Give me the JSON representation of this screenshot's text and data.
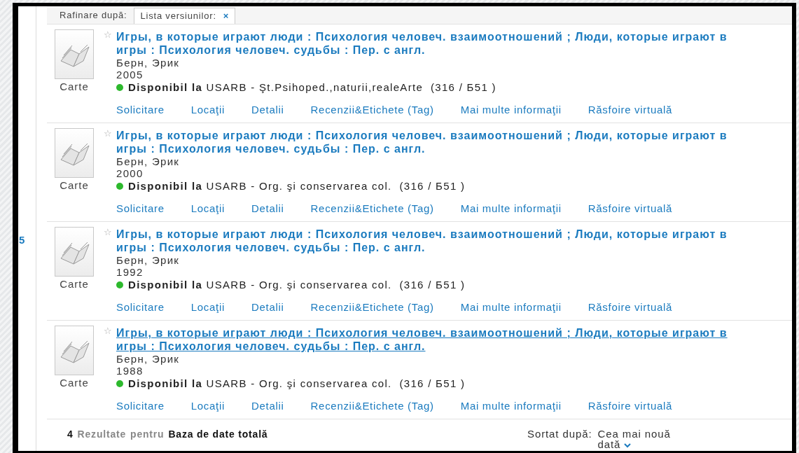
{
  "refine_bar": {
    "label": "Rafinare după:",
    "tag": {
      "label": "Lista versiunilor:",
      "close": "×"
    }
  },
  "side_marker": "5",
  "records": [
    {
      "title": "Игры, в которые играют люди : Психология человеч. взаимоотношений ; Люди, которые играют в игры : Психология человеч. судьбы : Пер. с англ.",
      "hovered": false,
      "star": "☆",
      "author": "Берн, Эрик",
      "year": "2005",
      "type": "Carte",
      "availability": "**Disponibil la** USARB - Şt.Psihoped.,naturii,realeArte  (316 / Б51 )",
      "color": "#2db92d",
      "links": [
        "Solicitare",
        "Locaţii",
        "Detalii",
        "Recenzii&Etichete (Tag)",
        "Mai multe informaţii",
        "Răsfoire virtuală"
      ]
    },
    {
      "title": "Игры, в которые играют люди : Психология человеч. взаимоотношений ; Люди, которые играют в игры : Психология человеч. судьбы : Пер. с англ.",
      "hovered": false,
      "star": "☆",
      "author": "Берн, Эрик",
      "year": "2000",
      "type": "Carte",
      "availability": "**Disponibil la** USARB - Org. şi conservarea col.  (316 / Б51 )",
      "color": "#2db92d",
      "links": [
        "Solicitare",
        "Locaţii",
        "Detalii",
        "Recenzii&Etichete (Tag)",
        "Mai multe informaţii",
        "Răsfoire virtuală"
      ]
    },
    {
      "title": "Игры, в которые играют люди : Психология человеч. взаимоотношений ; Люди, которые играют в игры : Психология человеч. судьбы : Пер. с англ.",
      "hovered": false,
      "star": "☆",
      "author": "Берн, Эрик",
      "year": "1992",
      "type": "Carte",
      "availability": "**Disponibil la** USARB - Org. şi conservarea col.  (316 / Б51 )",
      "color": "#2db92d",
      "links": [
        "Solicitare",
        "Locaţii",
        "Detalii",
        "Recenzii&Etichete (Tag)",
        "Mai multe informaţii",
        "Răsfoire virtuală"
      ]
    },
    {
      "title": "Игры, в которые играют люди : Психология человеч. взаимоотношений ; Люди, которые играют в игры : Психология человеч. судьбы : Пер. с англ.",
      "hovered": true,
      "star": "☆",
      "author": "Берн, Эрик",
      "year": "1988",
      "type": "Carte",
      "availability": "**Disponibil la** USARB - Org. şi conservarea col.  (316 / Б51 )",
      "color": "#2db92d",
      "links": [
        "Solicitare",
        "Locaţii",
        "Detalii",
        "Recenzii&Etichete (Tag)",
        "Mai multe informaţii",
        "Răsfoire virtuală"
      ]
    }
  ],
  "summary": {
    "count": "4",
    "label": "Rezultate",
    "connector": "pentru",
    "database": "Baza de date totală"
  },
  "sort": {
    "label": "Sortat după:",
    "value": "Cea mai nouă dată"
  }
}
